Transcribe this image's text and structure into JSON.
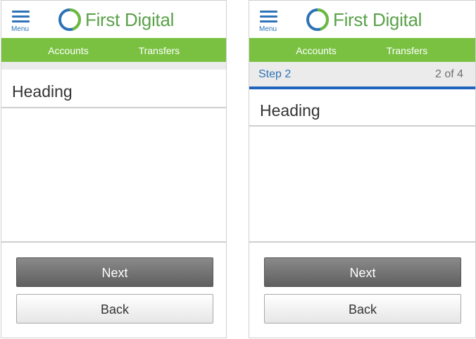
{
  "app": {
    "brand": "First Digital",
    "menu_label": "Menu",
    "brand_green": "#7ac142",
    "brand_blue": "#2e72b7"
  },
  "nav": {
    "accounts": "Accounts",
    "transfers": "Transfers"
  },
  "screens": [
    {
      "heading": "Heading",
      "next_label": "Next",
      "back_label": "Back"
    },
    {
      "step_label": "Step 2",
      "step_count": "2 of 4",
      "step_current": 2,
      "step_total": 4,
      "heading": "Heading",
      "next_label": "Next",
      "back_label": "Back"
    }
  ]
}
